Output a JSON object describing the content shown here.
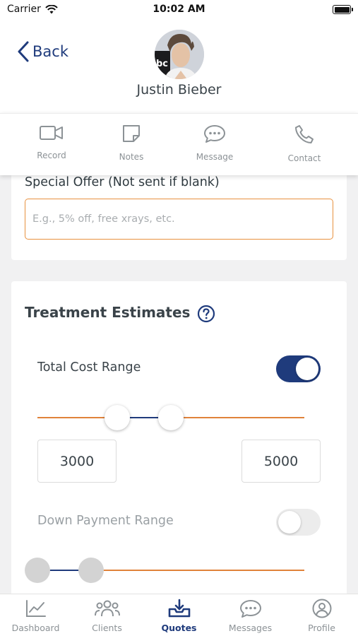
{
  "status_bar": {
    "carrier": "Carrier",
    "time": "10:02 AM",
    "battery_level": 1.0
  },
  "header": {
    "back_label": "Back",
    "client_name": "Justin Bieber",
    "avatar_logo_text": "bc"
  },
  "actions": [
    {
      "label": "Record",
      "icon": "video-camera-icon"
    },
    {
      "label": "Notes",
      "icon": "note-icon"
    },
    {
      "label": "Message",
      "icon": "chat-bubble-icon"
    },
    {
      "label": "Contact",
      "icon": "phone-icon"
    }
  ],
  "special_offer": {
    "label": "Special Offer (Not sent if blank)",
    "value": "",
    "placeholder": "E.g., 5% off, free xrays, etc."
  },
  "treatment_estimates": {
    "title": "Treatment Estimates",
    "help_icon": "question-circle-icon",
    "total_cost": {
      "label": "Total Cost Range",
      "enabled": true,
      "min_value": "3000",
      "max_value": "5000",
      "slider_low_fraction": 0.3,
      "slider_high_fraction": 0.5
    },
    "down_payment": {
      "label": "Down Payment Range",
      "enabled": false,
      "slider_low_fraction": 0.0,
      "slider_high_fraction": 0.2
    }
  },
  "tabs": [
    {
      "label": "Dashboard",
      "icon": "chart-icon",
      "active": false
    },
    {
      "label": "Clients",
      "icon": "users-icon",
      "active": false
    },
    {
      "label": "Quotes",
      "icon": "inbox-download-icon",
      "active": true
    },
    {
      "label": "Messages",
      "icon": "chat-bubble-icon",
      "active": false
    },
    {
      "label": "Profile",
      "icon": "user-circle-icon",
      "active": false
    }
  ],
  "colors": {
    "primary": "#1f3b7c",
    "accent": "#e8913f",
    "muted": "#8c9296"
  }
}
